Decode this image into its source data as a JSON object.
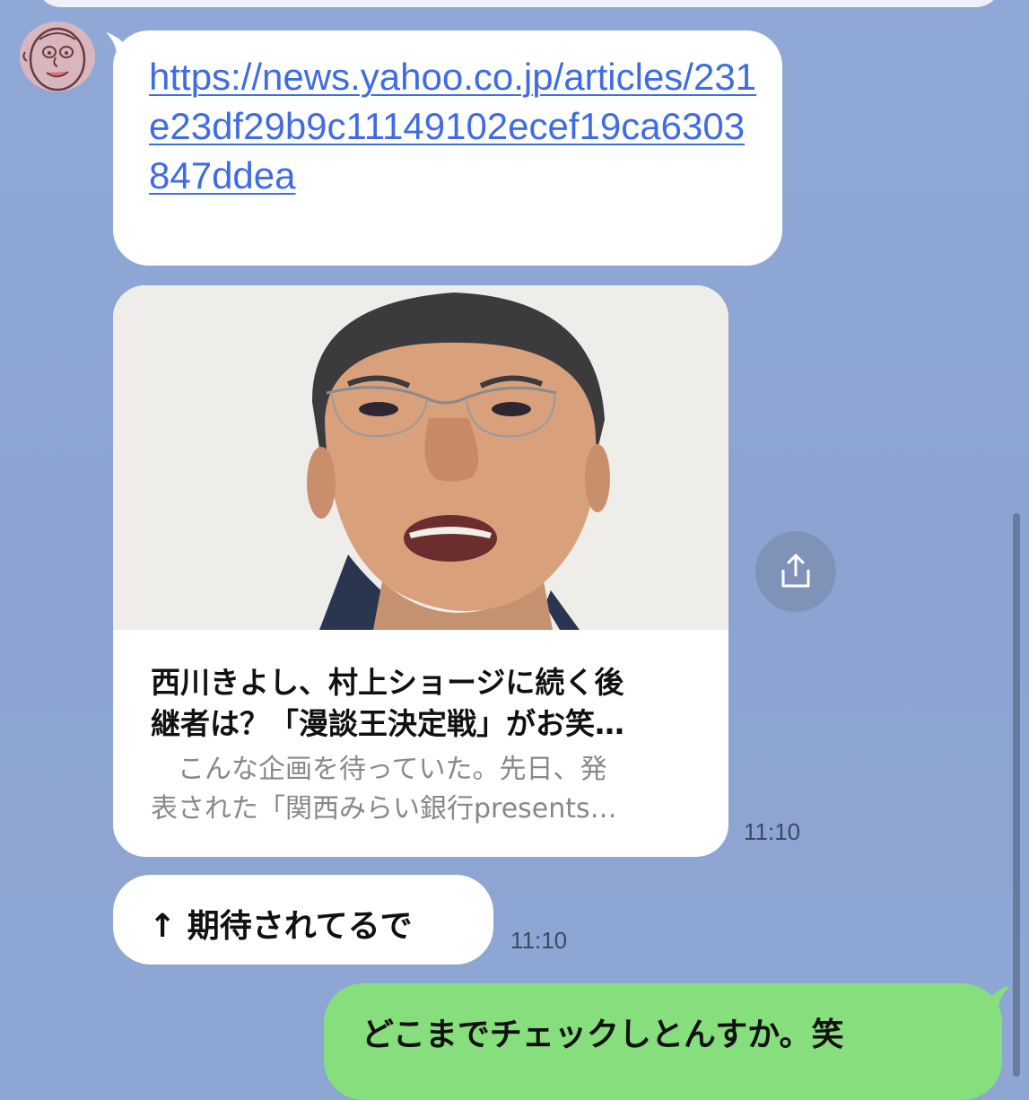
{
  "chat": {
    "background_color": "#8DA5D3",
    "incoming_link": {
      "url": "https://news.yahoo.co.jp/articles/231e23df29b9c11149102ecef19ca6303847ddea"
    },
    "link_card": {
      "title": "西川きよし、村上ショージに続く後\n継者は？「漫談王決定戦」がお笑…",
      "description": "　こんな企画を待っていた。先日、発\n表された「関西みらい銀行presents…",
      "time": "11:10"
    },
    "incoming_text": {
      "text": "↑ 期待されてるで",
      "time": "11:10"
    },
    "outgoing_text": {
      "text": "どこまでチェックしとんすか。笑",
      "bubble_color": "#86DE7C"
    },
    "icons": {
      "avatar": "cartoon-face-avatar",
      "share": "share-icon"
    }
  }
}
